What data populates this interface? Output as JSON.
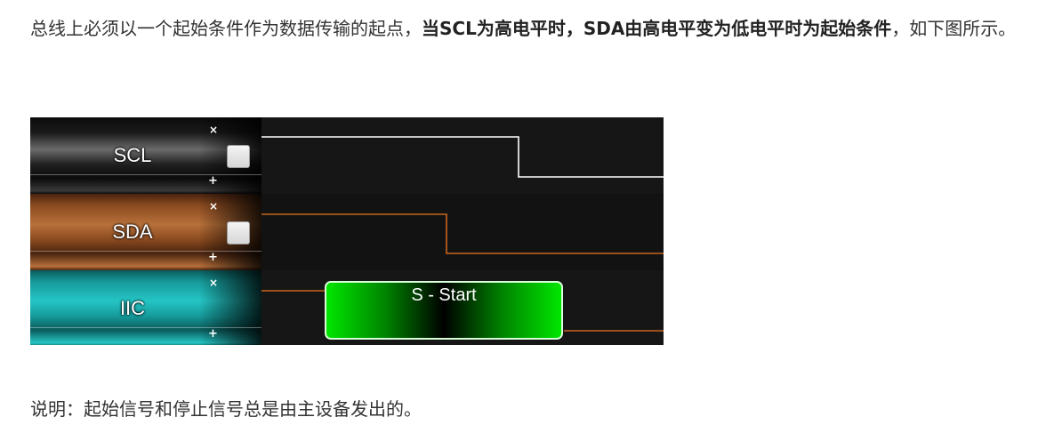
{
  "paragraph_top": {
    "text_lead": "总线上必须以一个起始条件作为数据传输的起点，",
    "text_bold": "当SCL为高电平时，SDA由高电平变为低电平时为起始条件",
    "text_tail": "，如下图所示。"
  },
  "figure": {
    "lanes": [
      {
        "name": "SCL",
        "remove_symbol": "×",
        "add_symbol": "+"
      },
      {
        "name": "SDA",
        "remove_symbol": "×",
        "add_symbol": "+"
      },
      {
        "name": "IIC",
        "remove_symbol": "×",
        "add_symbol": "+"
      }
    ],
    "frame_label": "S - Start",
    "colors": {
      "scl_wave": "#ffffff",
      "sda_wave": "#c8641e",
      "iic_wave": "#c8641e",
      "frame_fill": "#00d000"
    }
  },
  "paragraph_bottom": {
    "text": "说明：起始信号和停止信号总是由主设备发出的。"
  }
}
